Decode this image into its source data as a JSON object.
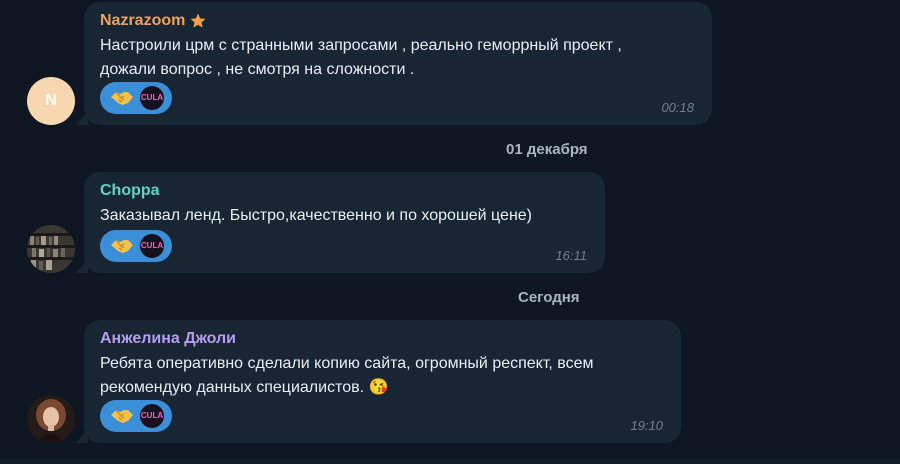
{
  "messages": [
    {
      "sender": "Nazrazoom",
      "sender_color": "#f0a05a",
      "sender_badge": "star-icon",
      "avatar_letter": "N",
      "text": "Настроили црм с странными запросами , реально геморрный проект ,\nдожали вопрос , не смотря на сложности .",
      "reaction_emoji": "handshake-icon",
      "reaction_user": "CULA",
      "time": "00:18"
    },
    {
      "sender": "Choppa",
      "sender_color": "#5ed4c4",
      "avatar_image": "bookshelf-photo",
      "text": "Заказывал ленд. Быстро,качественно и по хорошей цене)",
      "reaction_emoji": "handshake-icon",
      "reaction_user": "CULA",
      "time": "16:11"
    },
    {
      "sender": "Анжелина Джоли",
      "sender_color": "#b79cf2",
      "avatar_image": "woman-portrait-photo",
      "text": "Ребята оперативно сделали копию сайта, огромный респект, всем\nрекомендую данных специалистов. 😘",
      "reaction_emoji": "handshake-icon",
      "reaction_user": "CULA",
      "time": "19:10"
    }
  ],
  "date_separators": [
    "01 декабря",
    "Сегодня"
  ]
}
